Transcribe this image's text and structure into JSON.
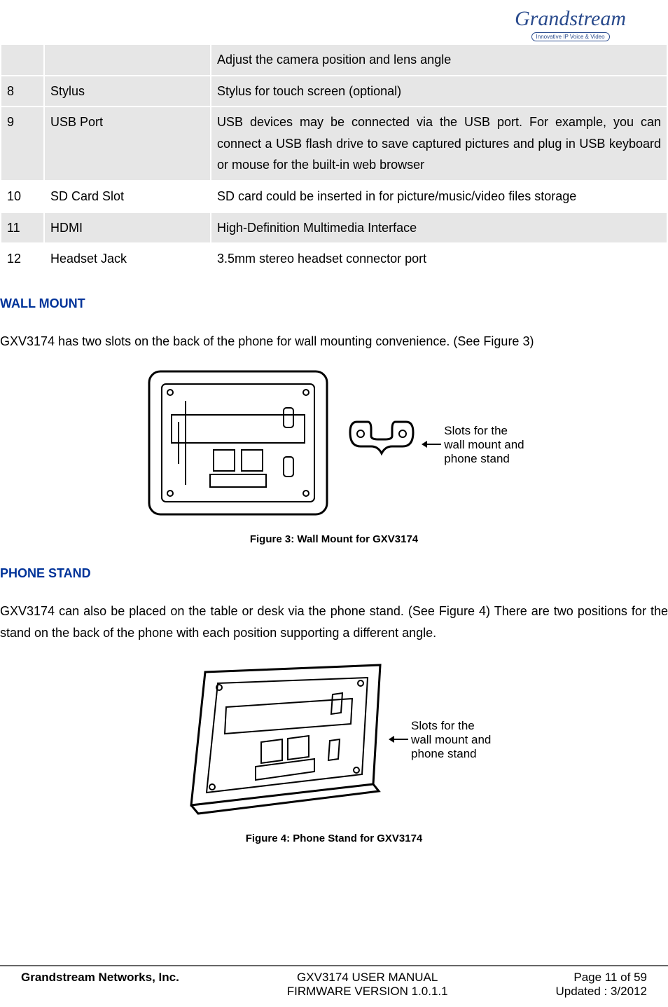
{
  "logo": {
    "brand": "Grandstream",
    "tagline": "Innovative IP Voice & Video"
  },
  "tableRows": [
    {
      "num": "",
      "name": "",
      "desc": "Adjust the camera position and lens angle",
      "shaded": true
    },
    {
      "num": "8",
      "name": "Stylus",
      "desc": "Stylus for touch screen (optional)",
      "shaded": true
    },
    {
      "num": "9",
      "name": "USB Port",
      "desc": "USB devices may be connected via the USB port. For example, you can connect a USB flash drive to save captured pictures and plug in USB keyboard or mouse for the built-in web browser",
      "shaded": true
    },
    {
      "num": "10",
      "name": "SD Card Slot",
      "desc": "SD card could be inserted in for picture/music/video files storage",
      "shaded": false
    },
    {
      "num": "11",
      "name": "HDMI",
      "desc": "High-Definition Multimedia Interface",
      "shaded": true
    },
    {
      "num": "12",
      "name": "Headset Jack",
      "desc": "3.5mm stereo headset connector port",
      "shaded": false
    }
  ],
  "sections": {
    "wall": {
      "heading": "WALL MOUNT",
      "body": "GXV3174 has two slots on the back of the phone for wall mounting convenience. (See Figure 3)",
      "callout": "Slots for the\nwall mount and\nphone stand",
      "caption": "Figure 3: Wall Mount for GXV3174"
    },
    "stand": {
      "heading": "PHONE STAND",
      "body": "GXV3174 can also be placed on the table or desk via the phone stand. (See Figure 4) There are two positions for the stand on the back of the phone with each position supporting a different angle.",
      "callout": "Slots for the\nwall mount and\nphone stand",
      "caption": "Figure 4: Phone Stand for GXV3174"
    }
  },
  "footer": {
    "company": "Grandstream Networks, Inc.",
    "manual": "GXV3174 USER MANUAL",
    "firmware": "FIRMWARE VERSION 1.0.1.1",
    "page": "Page 11 of 59",
    "updated": "Updated : 3/2012"
  }
}
